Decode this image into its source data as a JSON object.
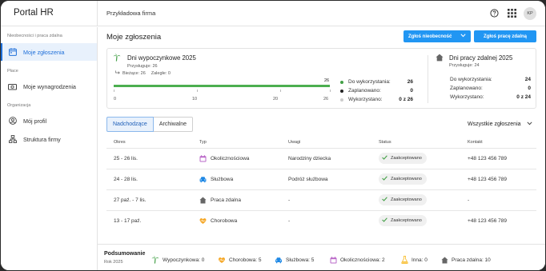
{
  "app": {
    "title": "Portal HR",
    "company": "Przykładowa firma",
    "avatar_initials": "KP"
  },
  "topbar": {
    "icons": [
      "help-icon",
      "apps-grid-icon"
    ]
  },
  "sidebar": {
    "sections": [
      {
        "label": "Nieobecności i praca zdalna",
        "items": [
          {
            "label": "Moje zgłoszenia",
            "icon": "calendar-icon",
            "active": true
          }
        ]
      },
      {
        "label": "Płace",
        "items": [
          {
            "label": "Moje wynagrodzenia",
            "icon": "money-icon",
            "active": false
          }
        ]
      },
      {
        "label": "Organizacja",
        "items": [
          {
            "label": "Mój profil",
            "icon": "person-icon",
            "active": false
          },
          {
            "label": "Struktura firmy",
            "icon": "org-chart-icon",
            "active": false
          }
        ]
      }
    ]
  },
  "main": {
    "title": "Moje zgłoszenia",
    "btn_absence": "Zgłoś nieobecność",
    "btn_remote": "Zgłoś pracę zdalną"
  },
  "vacation": {
    "title": "Dni wypoczynkowe 2025",
    "entitled_label": "Przysługuje:",
    "entitled": "26",
    "current_label": "Bieżące:",
    "current": "26",
    "overdue_label": "Zaległe:",
    "overdue": "0",
    "bar_value": "26",
    "bar_fraction": 1.0,
    "scale": [
      "0",
      "10",
      "20",
      "26"
    ],
    "to_use_label": "Do wykorzystania:",
    "to_use": "26",
    "planned_label": "Zaplanowano:",
    "planned": "0",
    "used_label": "Wykorzystano:",
    "used": "0 z 26"
  },
  "remote": {
    "title": "Dni pracy zdalnej 2025",
    "entitled_label": "Przysługuje:",
    "entitled": "24",
    "to_use_label": "Do wykorzystania:",
    "to_use": "24",
    "planned_label": "Zaplanowano:",
    "planned": "0",
    "used_label": "Wykorzystano:",
    "used": "0 z 24"
  },
  "tabs": [
    "Nadchodzące",
    "Archiwalne"
  ],
  "filter": "Wszystkie zgłoszenia",
  "table": {
    "headers": [
      "Okres",
      "Typ",
      "Uwagi",
      "Status",
      "Kontakt"
    ],
    "rows": [
      {
        "period": "25 - 26 lis.",
        "type": "Okolicznościowa",
        "icon": "calendar-event-icon",
        "notes": "Narodziny dziecka",
        "status": "Zaakceptowano",
        "contact": "+48 123 456 789"
      },
      {
        "period": "24 - 28 lis.",
        "type": "Służbowa",
        "icon": "car-icon",
        "notes": "Podróż służbowa",
        "status": "Zaakceptowano",
        "contact": "+48 123 456 789"
      },
      {
        "period": "27 paź. - 7 lis.",
        "type": "Praca zdalna",
        "icon": "home-icon",
        "notes": "-",
        "status": "Zaakceptowano",
        "contact": "-"
      },
      {
        "period": "13 - 17 paź.",
        "type": "Chorobowa",
        "icon": "heart-icon",
        "notes": "-",
        "status": "Zaakceptowano",
        "contact": "+48 123 456 789"
      }
    ]
  },
  "summary": {
    "title": "Podsumowanie",
    "year": "Rok 2025",
    "items": [
      {
        "label": "Wypoczynkowa: 0",
        "icon": "palm-tree-icon"
      },
      {
        "label": "Chorobowa: 5",
        "icon": "heart-icon"
      },
      {
        "label": "Służbowa: 5",
        "icon": "car-icon"
      },
      {
        "label": "Okolicznościowa: 2",
        "icon": "calendar-event-icon"
      },
      {
        "label": "Inna: 0",
        "icon": "flask-icon"
      },
      {
        "label": "Praca zdalna: 10",
        "icon": "home-icon"
      }
    ]
  },
  "colors": {
    "accent": "#2196f3",
    "progress": "#4caf50",
    "planned": "#f5a623",
    "used": "#cccccc",
    "active_bg": "#e8f1fc"
  }
}
